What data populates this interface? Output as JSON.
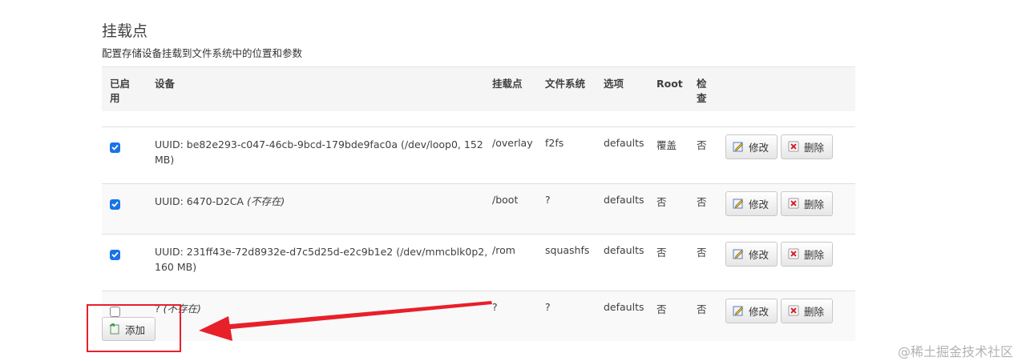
{
  "section": {
    "title": "挂载点",
    "description": "配置存储设备挂载到文件系统中的位置和参数"
  },
  "table": {
    "headers": {
      "enabled_line1": "已启",
      "enabled_line2": "用",
      "device": "设备",
      "mountpoint": "挂载点",
      "filesystem": "文件系统",
      "options": "选项",
      "root": "Root",
      "check_line1": "检",
      "check_line2": "查"
    },
    "rows": [
      {
        "enabled": true,
        "device": "UUID: be82e293-c047-46cb-9bcd-179bde9fac0a (/dev/loop0, 152",
        "device_line2": "MB)",
        "device_note": "",
        "mountpoint": "/overlay",
        "filesystem": "f2fs",
        "options": "defaults",
        "root": "覆盖",
        "check": "否"
      },
      {
        "enabled": true,
        "device": "UUID: 6470-D2CA ",
        "device_line2": "",
        "device_note": "(不存在)",
        "mountpoint": "/boot",
        "filesystem": "?",
        "options": "defaults",
        "root": "否",
        "check": "否"
      },
      {
        "enabled": true,
        "device": "UUID: 231ff43e-72d8932e-d7c5d25d-e2c9b1e2 (/dev/mmcblk0p2,",
        "device_line2": "160 MB)",
        "device_note": "",
        "mountpoint": "/rom",
        "filesystem": "squashfs",
        "options": "defaults",
        "root": "否",
        "check": "否"
      },
      {
        "enabled": false,
        "device": "? ",
        "device_line2": "",
        "device_note": "(不存在)",
        "mountpoint": "?",
        "filesystem": "?",
        "options": "defaults",
        "root": "否",
        "check": "否"
      }
    ],
    "actions": {
      "edit_label": "修改",
      "delete_label": "删除"
    }
  },
  "add_button": {
    "label": "添加"
  },
  "annotation": {
    "box_color": "#e8202a",
    "arrow_color": "#e8202a"
  },
  "watermark": "@稀土掘金技术社区",
  "colors": {
    "checkbox_checked": "#1a73e8",
    "header_bg": "#f5f5f5"
  },
  "icons": {
    "edit": "edit-icon",
    "delete": "delete-icon",
    "add": "add-icon",
    "check": "checkmark-icon"
  }
}
